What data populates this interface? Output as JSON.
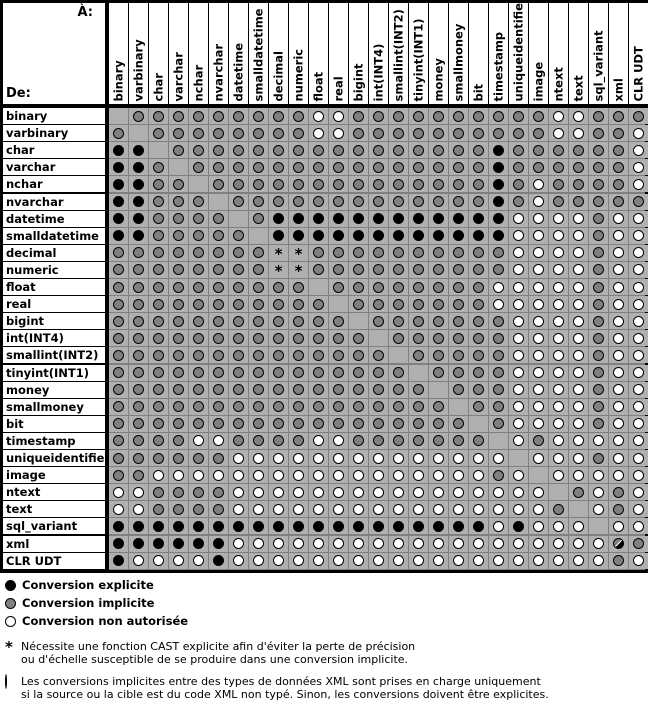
{
  "corner": {
    "to_label": "À:",
    "from_label": "De:"
  },
  "types": [
    "binary",
    "varbinary",
    "char",
    "varchar",
    "nchar",
    "nvarchar",
    "datetime",
    "smalldatetime",
    "decimal",
    "numeric",
    "float",
    "real",
    "bigint",
    "int(INT4)",
    "smallint(INT2)",
    "tinyint(INT1)",
    "money",
    "smallmoney",
    "bit",
    "timestamp",
    "uniqueidentifier",
    "image",
    "ntext",
    "text",
    "sql_variant",
    "xml",
    "CLR UDT"
  ],
  "symbol_codes": {
    "B": "explicit",
    "G": "implicit",
    "W": "not-allowed",
    "-": "same-type",
    "*": "explicit-cast-required",
    "H": "xml-special"
  },
  "matrix": [
    "-GGGGGGGGGWWGGGGGGGGGGWWGGG",
    "G-GGGGGGGGWWGGGGGGGGGGWWGGW",
    "BB-GGGGGGGGGGGGGGGGBGGGGGGW",
    "BBG-GGGGGGGGGGGGGGGBGGGGGGW",
    "BBGG-GGGGGGGGGGGGGGBGWGGGGW",
    "BBGGG-GGGGGGGGGGGGGBGWGGGGG",
    "BBGGGG-GBBBBBBBBBBBBWWWWGWW",
    "BBGGGGG-BBBBBBBBBBBBWWWWGWW",
    "GGGGGGGG**GGGGGGGGGGWWWWGWW",
    "GGGGGGGG**GGGGGGGGGGWWWWGWW",
    "GGGGGGGGGG-GGGGGGGGWWWWWGWW",
    "GGGGGGGGGGG-GGGGGGGWWWWWGWW",
    "GGGGGGGGGGGG-GGGGGGGWWWWGWW",
    "GGGGGGGGGGGGG-GGGGGGWWWWGWW",
    "GGGGGGGGGGGGGG-GGGGGWWWWGWW",
    "GGGGGGGGGGGGGGG-GGGGWWWWGWW",
    "GGGGGGGGGGGGGGGG-GGGWWWWGWW",
    "GGGGGGGGGGGGGGGGG-GGWWWWGWW",
    "GGGGGGGGGGGGGGGGGG-GWWWWGWW",
    "GGGGWWGGGGWWGGGGGGG-WGWWWWW",
    "GGGGGGWWWWWWWWWWWWWW-WWWGWW",
    "GGWWWWWWWWWWWWWWWWWGW-WWWWW",
    "WWGGGGWWWWWWWWWWWWWWWW-GWGW",
    "WWGGGGWWWWWWWWWWWWWWWWG-WGW",
    "BBBBBBBBBBBBBBBBBBBWBWWW-WW",
    "BBBBBBWWWWWWWWWWWWWWWWWWWHG",
    "BWWWWBWWWWWWWWWWWWWWWWWWWGW"
  ],
  "legend": {
    "items": [
      {
        "symbol": "B",
        "label": "Conversion explicite"
      },
      {
        "symbol": "G",
        "label": "Conversion implicite"
      },
      {
        "symbol": "W",
        "label": "Conversion non autorisée"
      }
    ],
    "notes": [
      {
        "symbol": "*",
        "lines": [
          "Nécessite une fonction CAST explicite afin d'éviter la perte de précision",
          "ou d'échelle susceptible de se produire dans une conversion implicite."
        ]
      },
      {
        "symbol": "H",
        "lines": [
          "Les conversions implicites entre des types de données XML sont prises en charge uniquement",
          "si la source ou la cible est du code XML non typé. Sinon, les conversions doivent être explicites."
        ]
      }
    ]
  }
}
